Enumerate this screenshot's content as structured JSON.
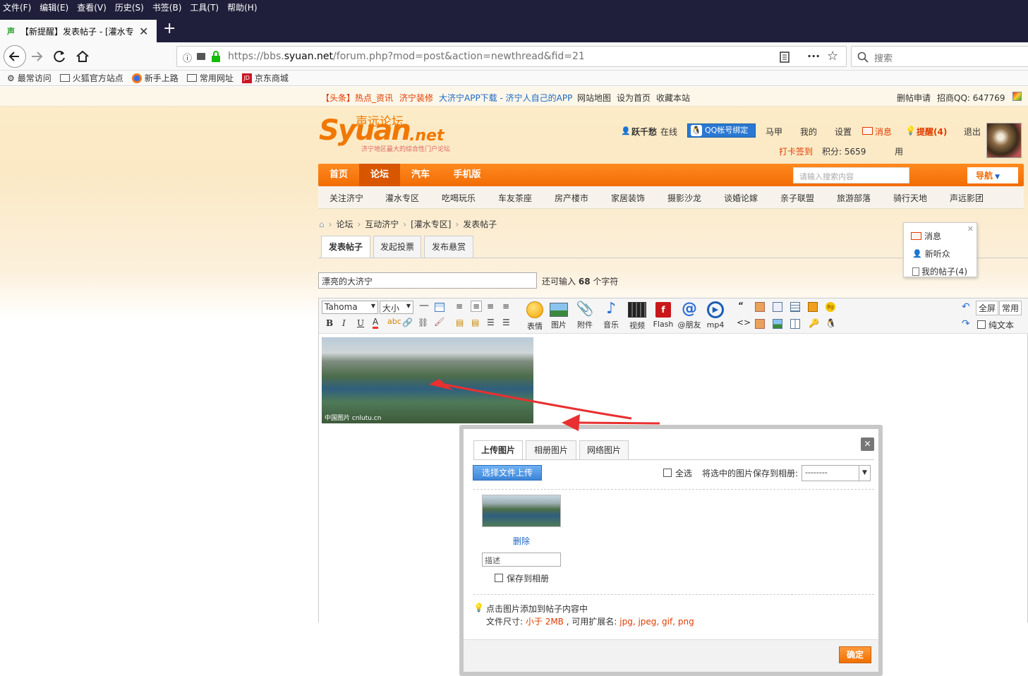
{
  "menu": [
    "文件(F)",
    "编辑(E)",
    "查看(V)",
    "历史(S)",
    "书签(B)",
    "工具(T)",
    "帮助(H)"
  ],
  "browser": {
    "tab_title": "【新提醒】发表帖子 - [灌水专区",
    "url_prefix": "https://bbs.",
    "url_host": "syuan.net",
    "url_path": "/forum.php?mod=post&action=newthread&fid=21",
    "search_placeholder": "搜索",
    "bookmarks": [
      "最常访问",
      "火狐官方站点",
      "新手上路",
      "常用网址",
      "京东商城"
    ]
  },
  "topbar": {
    "headline": "【头条】热点_资讯",
    "links": [
      "济宁装修",
      "大济宁APP下载 - 济宁人自己的APP",
      "网站地图",
      "设为首页",
      "收藏本站"
    ],
    "right": [
      "删帖申请",
      "招商QQ: 647769"
    ]
  },
  "logo": {
    "text": "Syuan",
    "suffix": ".net",
    "cn": "声远论坛",
    "tagline": "济宁地区最大的综合性门户论坛"
  },
  "user": {
    "name": "跃千愁",
    "status": "在线",
    "qq_bind": "QQ帐号绑定",
    "links": [
      "马甲",
      "我的",
      "设置"
    ],
    "message": "消息",
    "remind": "提醒(4)",
    "logout": "退出",
    "signin": "打卡签到",
    "points": "积分: 5659",
    "use": "用"
  },
  "popup": {
    "items": [
      "消息",
      "新听众",
      "我的帖子(4)"
    ]
  },
  "nav": {
    "items": [
      "首页",
      "论坛",
      "汽车",
      "手机版"
    ],
    "search_placeholder": "请输入搜索内容",
    "quick": "导航"
  },
  "subnav": [
    "关注济宁",
    "灌水专区",
    "吃喝玩乐",
    "车友茶座",
    "房产楼市",
    "家居装饰",
    "摄影沙龙",
    "谈婚论嫁",
    "亲子联盟",
    "旅游部落",
    "骑行天地",
    "声远影团"
  ],
  "breadcrumb": [
    "论坛",
    "互动济宁",
    "[灌水专区]",
    "发表帖子"
  ],
  "post_tabs": [
    "发表帖子",
    "发起投票",
    "发布悬赏"
  ],
  "title_input": {
    "value": "漂亮的大济宁",
    "remain_prefix": "还可输入",
    "remain_count": "68",
    "remain_suffix": "个字符"
  },
  "editor": {
    "font": "Tahoma",
    "size": "大小",
    "buttons": [
      "表情",
      "图片",
      "附件",
      "音乐",
      "视频",
      "Flash",
      "@朋友",
      "mp4"
    ],
    "right": [
      "全屏",
      "常用",
      "纯文本"
    ],
    "image_caption": "中国图片 cnlutu.cn"
  },
  "dialog": {
    "tabs": [
      "上传图片",
      "相册图片",
      "网络图片"
    ],
    "upload_btn": "选择文件上传",
    "select_all": "全选",
    "save_to_album_label": "将选中的图片保存到相册:",
    "album_value": "--------",
    "delete": "删除",
    "desc_placeholder": "描述",
    "save_checkbox": "保存到相册",
    "tip": "点击图片添加到帖子内容中",
    "size_label": "文件尺寸:",
    "size_value": "小于 2MB",
    "ext_label": ", 可用扩展名:",
    "ext_value": "jpg, jpeg, gif, png",
    "ok": "确定"
  },
  "colors": {
    "accent": "#f26c05",
    "link_red": "#e03c00",
    "browser_dark": "#1f1f3b",
    "blue": "#1e66c2"
  }
}
